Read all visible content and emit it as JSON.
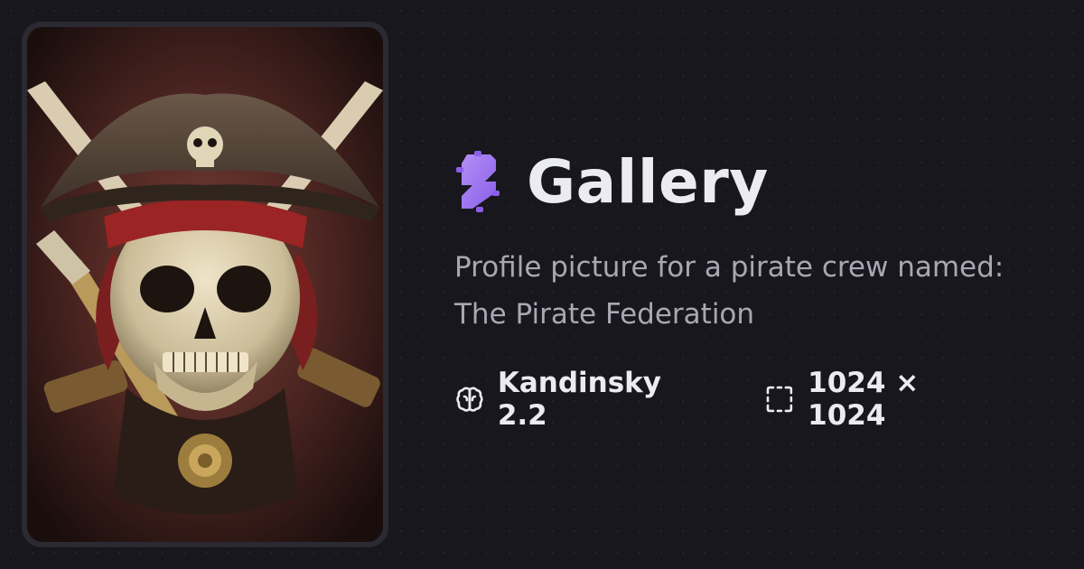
{
  "header": {
    "title": "Gallery",
    "logo_icon": "gear-bolt-logo-icon",
    "accent": "#a77bf3"
  },
  "image": {
    "subject": "pirate-skull-crossed-swords",
    "description": "Profile picture for a pirate crew named: The Pirate Federation"
  },
  "meta": {
    "model_icon": "brain-icon",
    "model": "Kandinsky 2.2",
    "size_icon": "dashed-square-icon",
    "dimensions": "1024 × 1024"
  },
  "colors": {
    "background": "#18171d",
    "title": "#ebebf2",
    "description": "#a8a8b4"
  }
}
